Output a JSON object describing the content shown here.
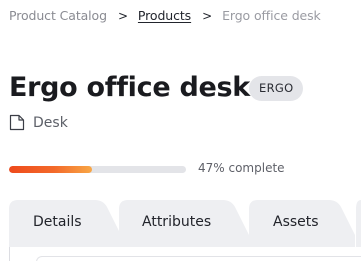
{
  "breadcrumb": {
    "root": "Product Catalog",
    "separator": ">",
    "category": "Products",
    "current": "Ergo office desk"
  },
  "product": {
    "title": "Ergo office desk",
    "badge": "ERGO",
    "type_label": "Desk",
    "type_icon": "document-icon"
  },
  "progress": {
    "value": 0.47,
    "label": "47% complete"
  },
  "tabs": [
    {
      "label": "Details"
    },
    {
      "label": "Attributes"
    },
    {
      "label": "Assets"
    }
  ],
  "colors": {
    "progress_start": "#ee4a1c",
    "progress_end": "#f8a746",
    "tab_bg": "#eeeff2",
    "badge_bg": "#e4e5e9"
  }
}
